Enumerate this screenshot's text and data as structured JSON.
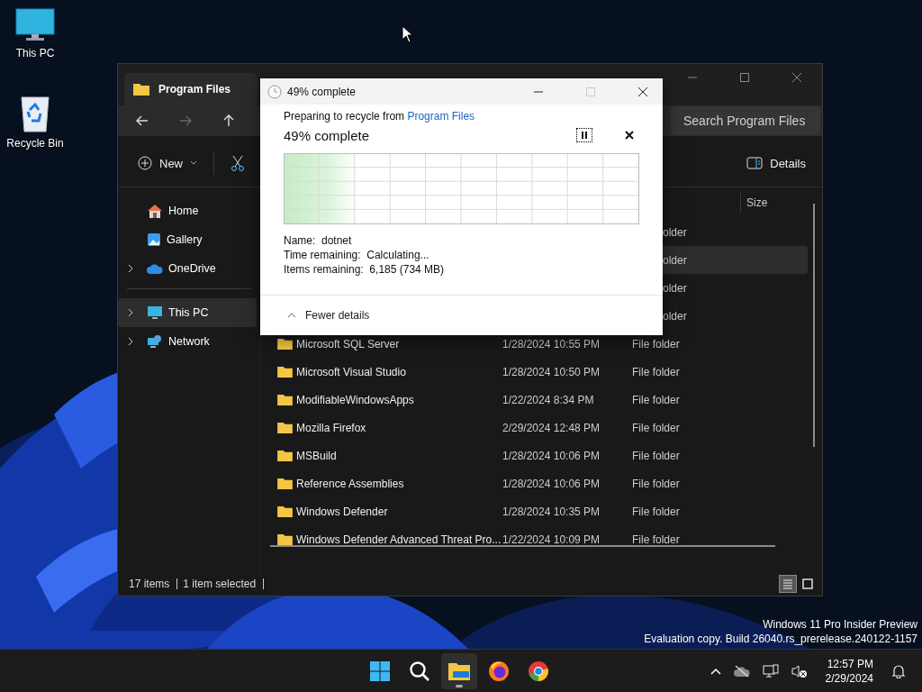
{
  "desktop_icons": [
    {
      "label": "This PC",
      "kind": "pc"
    },
    {
      "label": "Recycle Bin",
      "kind": "bin"
    }
  ],
  "explorer": {
    "tab_title": "Program Files",
    "search": {
      "placeholder": "Search Program Files"
    },
    "new_button": "New",
    "details_button": "Details",
    "sidebar_groups": [
      {
        "items": [
          {
            "label": "Home",
            "kind": "home",
            "expandable": false,
            "selected": false
          },
          {
            "label": "Gallery",
            "kind": "gallery",
            "expandable": false,
            "selected": false
          },
          {
            "label": "OneDrive",
            "kind": "cloud",
            "expandable": true,
            "selected": false
          }
        ]
      },
      {
        "items": [
          {
            "label": "This PC",
            "kind": "pc",
            "expandable": true,
            "selected": true
          },
          {
            "label": "Network",
            "kind": "network",
            "expandable": true,
            "selected": false
          }
        ]
      }
    ],
    "columns": [
      {
        "label": "Size"
      }
    ],
    "rows": [
      {
        "type": "older",
        "selected": false
      },
      {
        "type": "older",
        "selected": true
      },
      {
        "type": "older",
        "selected": false
      },
      {
        "type": "older",
        "selected": false
      },
      {
        "name": "Microsoft SQL Server",
        "date": "1/28/2024 10:55 PM",
        "type": "File folder",
        "selected": false
      },
      {
        "name": "Microsoft Visual Studio",
        "date": "1/28/2024 10:50 PM",
        "type": "File folder",
        "selected": false
      },
      {
        "name": "ModifiableWindowsApps",
        "date": "1/22/2024 8:34 PM",
        "type": "File folder",
        "selected": false
      },
      {
        "name": "Mozilla Firefox",
        "date": "2/29/2024 12:48 PM",
        "type": "File folder",
        "selected": false
      },
      {
        "name": "MSBuild",
        "date": "1/28/2024 10:06 PM",
        "type": "File folder",
        "selected": false
      },
      {
        "name": "Reference Assemblies",
        "date": "1/28/2024 10:06 PM",
        "type": "File folder",
        "selected": false
      },
      {
        "name": "Windows Defender",
        "date": "1/28/2024 10:35 PM",
        "type": "File folder",
        "selected": false
      },
      {
        "name": "Windows Defender Advanced Threat Pro...",
        "date": "1/22/2024 10:09 PM",
        "type": "File folder",
        "selected": false
      }
    ],
    "status": [
      "17 items",
      "1 item selected"
    ],
    "view_modes": [
      {
        "kind": "details",
        "selected": true
      },
      {
        "kind": "tiles",
        "selected": false
      }
    ]
  },
  "dialog": {
    "title": "49% complete",
    "source_prefix": "Preparing to recycle from",
    "source_link": "Program Files",
    "heading": "49% complete",
    "maximize_disabled": true,
    "details": [
      {
        "label": "Name:",
        "value": "dotnet"
      },
      {
        "label": "Time remaining:",
        "value": "Calculating..."
      },
      {
        "label": "Items remaining:",
        "value": "6,185 (734 MB)"
      }
    ],
    "toggle": "Fewer details"
  },
  "watermark": [
    "Windows 11 Pro Insider Preview",
    "Evaluation copy. Build 26040.rs_prerelease.240122-1157"
  ],
  "taskbar": {
    "apps": [
      {
        "kind": "start",
        "selected": false
      },
      {
        "kind": "search",
        "selected": false
      },
      {
        "kind": "explorer",
        "selected": true
      },
      {
        "kind": "firefox",
        "selected": false
      },
      {
        "kind": "chrome",
        "selected": false
      }
    ],
    "time": "12:57 PM",
    "date": "2/29/2024"
  }
}
